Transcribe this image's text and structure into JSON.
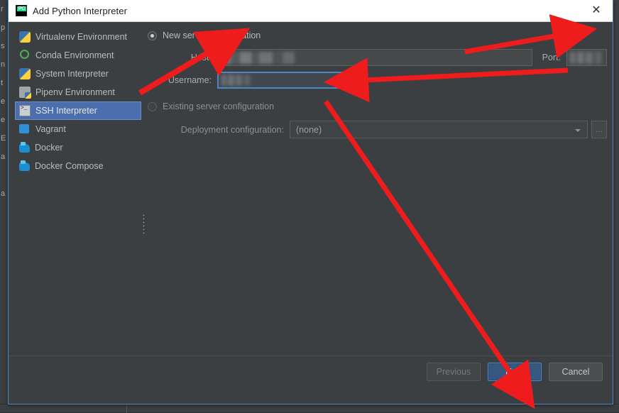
{
  "window": {
    "title": "Add Python Interpreter",
    "close_label": "✕",
    "app_icon": "pycharm-icon"
  },
  "sidebar": {
    "items": [
      {
        "label": "Virtualenv Environment",
        "icon": "python-icon",
        "selected": false
      },
      {
        "label": "Conda Environment",
        "icon": "conda-icon",
        "selected": false
      },
      {
        "label": "System Interpreter",
        "icon": "python-icon",
        "selected": false
      },
      {
        "label": "Pipenv Environment",
        "icon": "pipenv-icon",
        "selected": false
      },
      {
        "label": "SSH Interpreter",
        "icon": "ssh-terminal-icon",
        "selected": true
      },
      {
        "label": "Vagrant",
        "icon": "vagrant-icon",
        "selected": false
      },
      {
        "label": "Docker",
        "icon": "docker-whale-icon",
        "selected": false
      },
      {
        "label": "Docker Compose",
        "icon": "docker-compose-icon",
        "selected": false
      }
    ]
  },
  "main": {
    "new_server": {
      "radio_label": "New server configuration",
      "selected": true,
      "host_label": "Host:",
      "host_value": "",
      "port_label": "Port:",
      "port_value": "",
      "username_label": "Username:",
      "username_value": ""
    },
    "existing_server": {
      "radio_label": "Existing server configuration",
      "selected": false,
      "deployment_label": "Deployment configuration:",
      "deployment_value": "(none)",
      "browse_label": "..."
    }
  },
  "footer": {
    "previous_label": "Previous",
    "next_label": "Next",
    "cancel_label": "Cancel"
  },
  "backdrop": {
    "left_glyphs": [
      "r",
      "p",
      "s",
      "n",
      "t",
      "e",
      "e",
      "E",
      "a",
      "",
      "a"
    ]
  },
  "colors": {
    "dialog_bg": "#3c3f41",
    "titlebar_bg": "#ffffff",
    "selection_blue": "#4b6eaf",
    "default_button_blue": "#365880",
    "window_border": "#4a86c8",
    "annotation_red": "#ee1c1c"
  }
}
